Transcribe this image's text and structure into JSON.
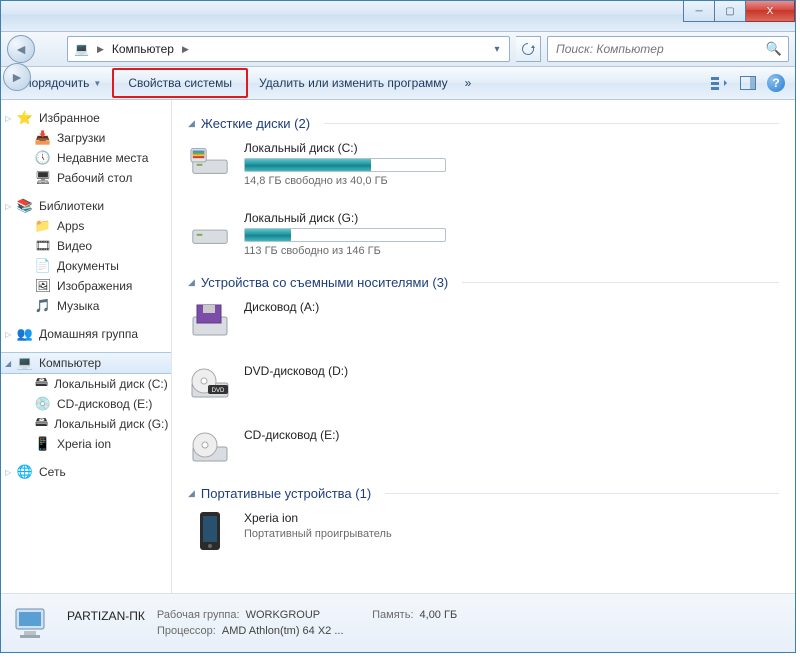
{
  "titlebar": {
    "min": "–",
    "max": "☐",
    "close": "X"
  },
  "nav": {
    "breadcrumb_root": "Компьютер",
    "search_placeholder": "Поиск: Компьютер"
  },
  "toolbar": {
    "organize": "Упорядочить",
    "system_props": "Свойства системы",
    "uninstall": "Удалить или изменить программу",
    "overflow": "»"
  },
  "sidebar": {
    "favorites": {
      "label": "Избранное",
      "items": [
        "Загрузки",
        "Недавние места",
        "Рабочий стол"
      ]
    },
    "libraries": {
      "label": "Библиотеки",
      "items": [
        "Apps",
        "Видео",
        "Документы",
        "Изображения",
        "Музыка"
      ]
    },
    "homegroup": {
      "label": "Домашняя группа"
    },
    "computer": {
      "label": "Компьютер",
      "items": [
        "Локальный диск (C:)",
        "CD-дисковод (E:)",
        "Локальный диск (G:)",
        "Xperia ion"
      ]
    },
    "network": {
      "label": "Сеть"
    }
  },
  "sections": {
    "hdd": {
      "title": "Жесткие диски (2)"
    },
    "removable": {
      "title": "Устройства со съемными носителями (3)"
    },
    "portable": {
      "title": "Портативные устройства (1)"
    }
  },
  "drives": {
    "c": {
      "name": "Локальный диск (C:)",
      "free": "14,8 ГБ свободно из 40,0 ГБ",
      "pct": 63
    },
    "g": {
      "name": "Локальный диск (G:)",
      "free": "113 ГБ свободно из 146 ГБ",
      "pct": 23
    }
  },
  "removable": {
    "a": {
      "name": "Дисковод (A:)"
    },
    "d": {
      "name": "DVD-дисковод (D:)"
    },
    "e": {
      "name": "CD-дисковод (E:)"
    }
  },
  "portable": {
    "xperia": {
      "name": "Xperia ion",
      "sub": "Портативный проигрыватель"
    }
  },
  "status": {
    "pc_name": "PARTIZAN-ПК",
    "workgroup_lbl": "Рабочая группа:",
    "workgroup": "WORKGROUP",
    "cpu_lbl": "Процессор:",
    "cpu": "AMD Athlon(tm) 64 X2 ...",
    "mem_lbl": "Память:",
    "mem": "4,00 ГБ"
  },
  "icons": {
    "star": "⭐",
    "download": "📥",
    "recent": "🕔",
    "desktop": "🖥",
    "lib": "📚",
    "apps": "📁",
    "video": "🎞",
    "docs": "📄",
    "images": "🖼",
    "music": "🎵",
    "homegroup": "👥",
    "computer": "💻",
    "hdd": "🖴",
    "cd": "💿",
    "phone": "📱",
    "net": "🌐",
    "folder": "📁",
    "gear": "⚙",
    "help": "?"
  }
}
